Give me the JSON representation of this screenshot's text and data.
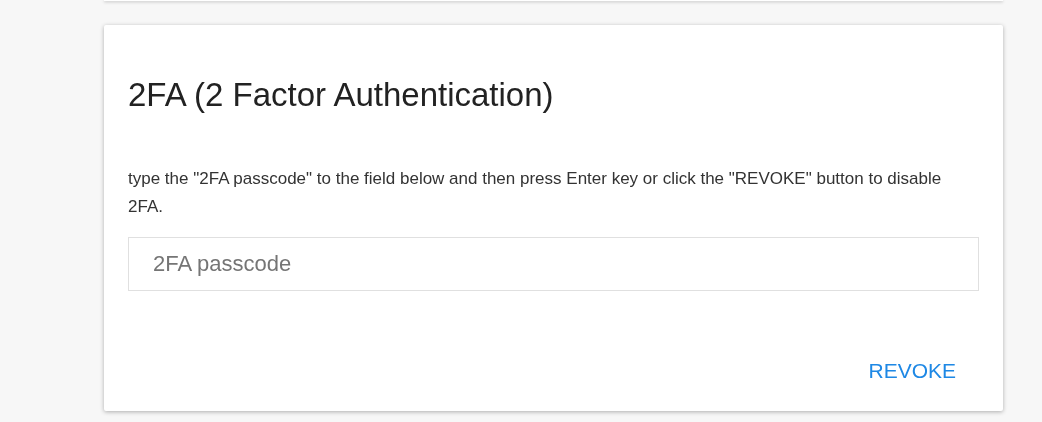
{
  "card": {
    "title": "2FA (2 Factor Authentication)",
    "instructions": "type the \"2FA passcode\" to the field below and then press Enter key or click the \"REVOKE\" button to disable 2FA.",
    "passcode_field": {
      "placeholder": "2FA passcode"
    },
    "buttons": [
      "REVOKE"
    ]
  }
}
